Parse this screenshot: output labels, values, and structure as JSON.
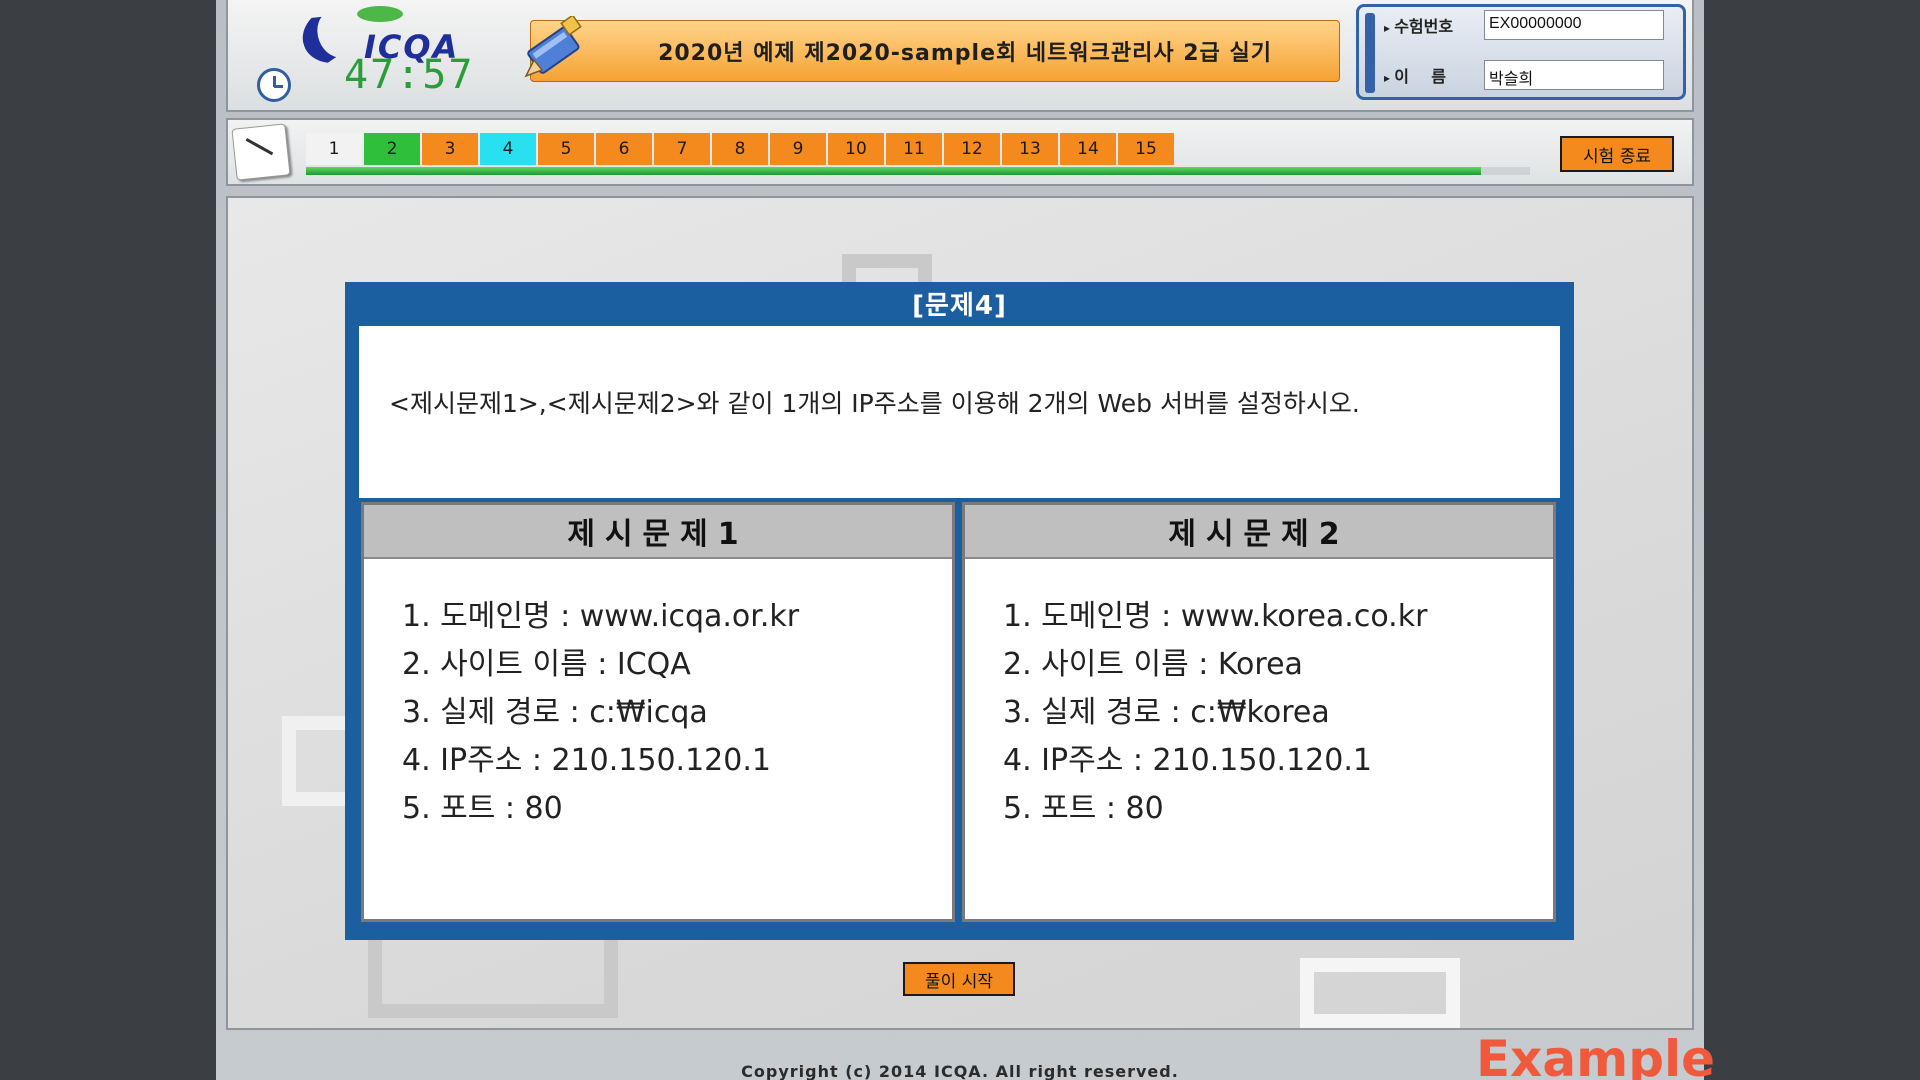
{
  "header": {
    "logo_text": "ICQA",
    "timer": "47:57",
    "exam_title": "2020년 예제 제2020-sample회 네트워크관리사 2급 실기",
    "candidate_no_label": "수험번호",
    "candidate_no_value": "EX00000000",
    "name_label": "이    름",
    "name_value": "박슬희"
  },
  "nav": {
    "questions": [
      {
        "label": "1",
        "color": "#f2f2f2"
      },
      {
        "label": "2",
        "color": "#2fbf3a"
      },
      {
        "label": "3",
        "color": "#f48a1e"
      },
      {
        "label": "4",
        "color": "#28e0f0"
      },
      {
        "label": "5",
        "color": "#f48a1e"
      },
      {
        "label": "6",
        "color": "#f48a1e"
      },
      {
        "label": "7",
        "color": "#f48a1e"
      },
      {
        "label": "8",
        "color": "#f48a1e"
      },
      {
        "label": "9",
        "color": "#f48a1e"
      },
      {
        "label": "10",
        "color": "#f48a1e"
      },
      {
        "label": "11",
        "color": "#f48a1e"
      },
      {
        "label": "12",
        "color": "#f48a1e"
      },
      {
        "label": "13",
        "color": "#f48a1e"
      },
      {
        "label": "14",
        "color": "#f48a1e"
      },
      {
        "label": "15",
        "color": "#f48a1e"
      }
    ],
    "progress_percent": 96,
    "end_button_label": "시험 종료"
  },
  "problem": {
    "title": "[문제4]",
    "prompt": "<제시문제1>,<제시문제2>와 같이 1개의 IP주소를 이용해 2개의 Web 서버를 설정하시오.",
    "cards": [
      {
        "heading": "제시문제1",
        "items": [
          "1. 도메인명 : www.icqa.or.kr",
          "2. 사이트 이름 : ICQA",
          "3. 실제 경로 : c:₩icqa",
          "4. IP주소 : 210.150.120.1",
          "5. 포트 : 80"
        ]
      },
      {
        "heading": "제시문제2",
        "items": [
          "1. 도메인명 : www.korea.co.kr",
          "2. 사이트 이름 : Korea",
          "3. 실제 경로 : c:₩korea",
          "4. IP주소 : 210.150.120.1",
          "5. 포트 : 80"
        ]
      }
    ],
    "start_button_label": "풀이 시작"
  },
  "footer": {
    "copyright": "Copyright (c) 2014 ICQA. All right reserved.",
    "watermark": "Example"
  },
  "colors": {
    "accent_orange": "#f48a1e",
    "problem_blue": "#1b5fa0",
    "done_green": "#2fbf3a",
    "current_cyan": "#28e0f0"
  }
}
